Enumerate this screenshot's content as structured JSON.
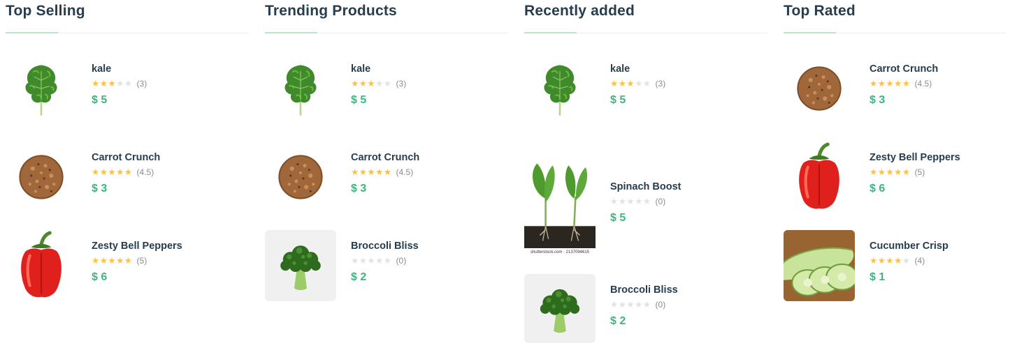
{
  "colors": {
    "accent": "#3bb77e",
    "heading": "#253d4e",
    "star_on": "#fdc040",
    "star_off": "#e2e2e2",
    "underline": "#bce3c9"
  },
  "columns": [
    {
      "title": "Top Selling",
      "items": [
        {
          "name": "kale",
          "stars": "★★★",
          "stars_off": "★★",
          "rating": 3,
          "count": "(3)",
          "price": "$ 5",
          "image_icon": "kale-image"
        },
        {
          "name": "Carrot Crunch",
          "stars": "★★★★★",
          "stars_off": "",
          "rating": 4.5,
          "count": "(4.5)",
          "price": "$ 3",
          "image_icon": "cookie-image"
        },
        {
          "name": "Zesty Bell Peppers",
          "stars": "★★★★★",
          "stars_off": "",
          "rating": 5,
          "count": "(5)",
          "price": "$ 6",
          "image_icon": "bell-pepper-image"
        }
      ]
    },
    {
      "title": "Trending Products",
      "items": [
        {
          "name": "kale",
          "stars": "★★★",
          "stars_off": "★★",
          "rating": 3,
          "count": "(3)",
          "price": "$ 5",
          "image_icon": "kale-image"
        },
        {
          "name": "Carrot Crunch",
          "stars": "★★★★★",
          "stars_off": "",
          "rating": 4.5,
          "count": "(4.5)",
          "price": "$ 3",
          "image_icon": "cookie-image"
        },
        {
          "name": "Broccoli Bliss",
          "stars": "",
          "stars_off": "★★★★★",
          "rating": 0,
          "count": "(0)",
          "price": "$ 2",
          "image_icon": "broccoli-image"
        }
      ]
    },
    {
      "title": "Recently added",
      "items": [
        {
          "name": "kale",
          "stars": "★★★",
          "stars_off": "★★",
          "rating": 3,
          "count": "(3)",
          "price": "$ 5",
          "image_icon": "kale-image"
        },
        {
          "name": "Spinach Boost",
          "stars": "",
          "stars_off": "★★★★★",
          "rating": 0,
          "count": "(0)",
          "price": "$ 5",
          "image_icon": "spinach-image",
          "watermark": "shutterstock.com · 2137094615"
        },
        {
          "name": "Broccoli Bliss",
          "stars": "",
          "stars_off": "★★★★★",
          "rating": 0,
          "count": "(0)",
          "price": "$ 2",
          "image_icon": "broccoli-image"
        }
      ]
    },
    {
      "title": "Top Rated",
      "items": [
        {
          "name": "Carrot Crunch",
          "stars": "★★★★★",
          "stars_off": "",
          "rating": 4.5,
          "count": "(4.5)",
          "price": "$ 3",
          "image_icon": "cookie-image"
        },
        {
          "name": "Zesty Bell Peppers",
          "stars": "★★★★★",
          "stars_off": "",
          "rating": 5,
          "count": "(5)",
          "price": "$ 6",
          "image_icon": "bell-pepper-image"
        },
        {
          "name": "Cucumber Crisp",
          "stars": "★★★★",
          "stars_off": "★",
          "rating": 4,
          "count": "(4)",
          "price": "$ 1",
          "image_icon": "cucumber-image"
        }
      ]
    }
  ]
}
